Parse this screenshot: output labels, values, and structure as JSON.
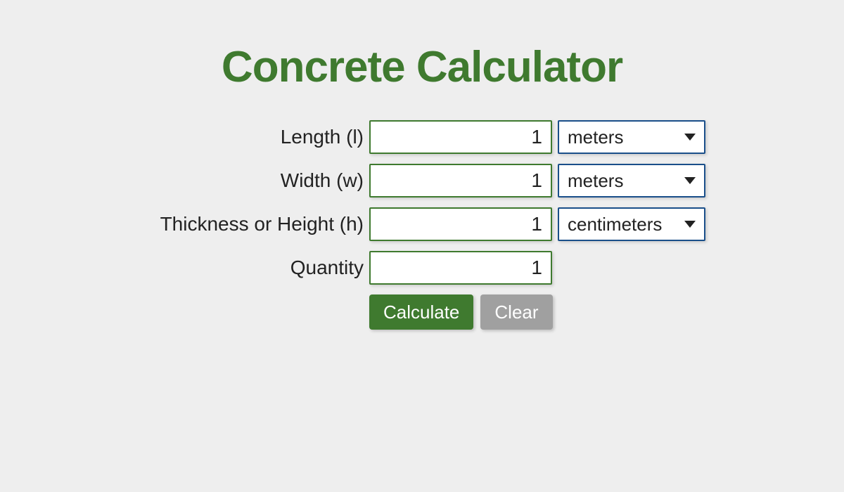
{
  "title": "Concrete Calculator",
  "colors": {
    "primary": "#3f7a2f",
    "select_border": "#1a4f8a",
    "secondary_btn": "#a0a0a0",
    "background": "#eeeeee"
  },
  "fields": {
    "length": {
      "label": "Length (l)",
      "value": "1",
      "unit": "meters"
    },
    "width": {
      "label": "Width (w)",
      "value": "1",
      "unit": "meters"
    },
    "thickness": {
      "label": "Thickness or Height (h)",
      "value": "1",
      "unit": "centimeters"
    },
    "quantity": {
      "label": "Quantity",
      "value": "1"
    }
  },
  "buttons": {
    "calculate": "Calculate",
    "clear": "Clear"
  }
}
